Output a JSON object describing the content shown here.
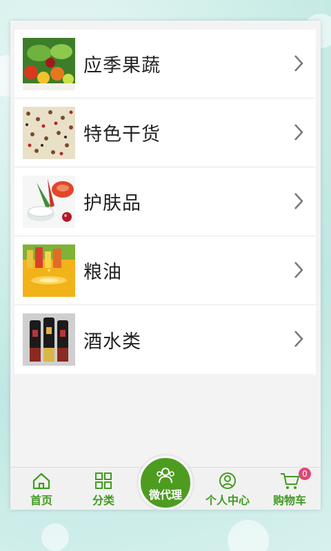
{
  "categories": [
    {
      "label": "应季果蔬",
      "thumb_icon": "vegetables-photo"
    },
    {
      "label": "特色干货",
      "thumb_icon": "grains-photo"
    },
    {
      "label": "护肤品",
      "thumb_icon": "skincare-photo"
    },
    {
      "label": "粮油",
      "thumb_icon": "cooking-oil-photo"
    },
    {
      "label": "酒水类",
      "thumb_icon": "liquor-bottles-photo"
    }
  ],
  "tabbar": {
    "home": "首页",
    "category": "分类",
    "agent": "微代理",
    "profile": "个人中心",
    "cart": "购物车",
    "cart_count": "0"
  },
  "colors": {
    "accent": "#4d9c1f",
    "badge": "#e0457b"
  }
}
